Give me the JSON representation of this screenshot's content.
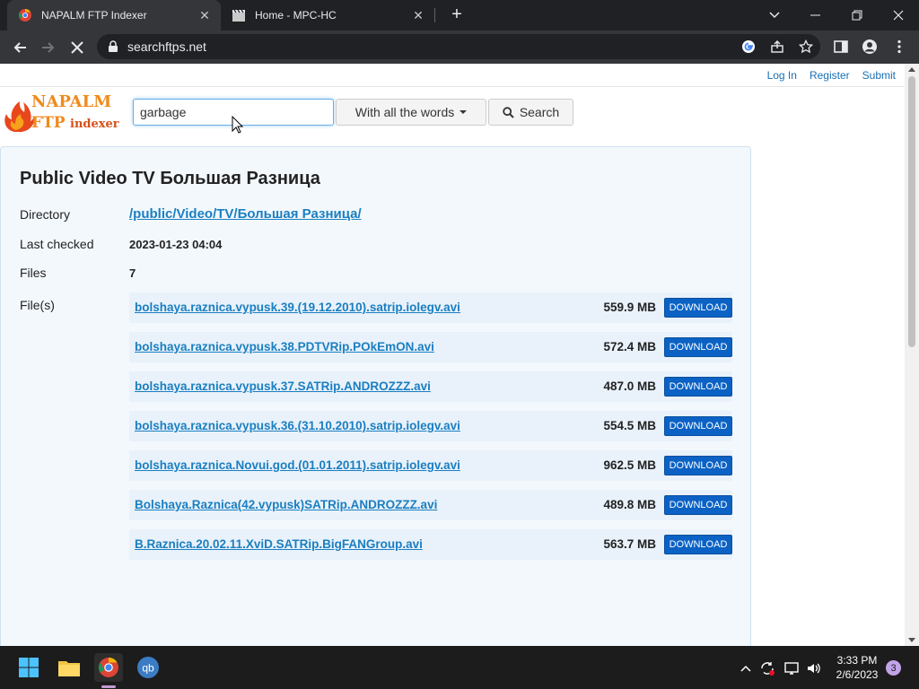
{
  "browser": {
    "tabs": [
      {
        "title": "NAPALM FTP Indexer",
        "active": true
      },
      {
        "title": "Home - MPC-HC",
        "active": false
      }
    ],
    "url": "searchftps.net"
  },
  "header": {
    "links": [
      "Log In",
      "Register",
      "Submit"
    ],
    "logo": {
      "line1": "NAPALM",
      "line2": "FTP",
      "line3": "indexer"
    }
  },
  "search": {
    "query": "garbage",
    "mode": "With all the words",
    "button": "Search"
  },
  "result": {
    "title": "Public Video TV Большая Разница",
    "directory_label": "Directory",
    "directory": "/public/Video/TV/Большая Разница/",
    "last_checked_label": "Last checked",
    "last_checked": "2023-01-23 04:04",
    "files_label": "Files",
    "files_count": "7",
    "filelist_label": "File(s)",
    "download_label": "DOWNLOAD",
    "files": [
      {
        "name": "bolshaya.raznica.vypusk.39.(19.12.2010).satrip.iolegv.avi",
        "size": "559.9 MB"
      },
      {
        "name": "bolshaya.raznica.vypusk.38.PDTVRip.POkEmON.avi",
        "size": "572.4 MB"
      },
      {
        "name": "bolshaya.raznica.vypusk.37.SATRip.ANDROZZZ.avi",
        "size": "487.0 MB"
      },
      {
        "name": "bolshaya.raznica.vypusk.36.(31.10.2010).satrip.iolegv.avi",
        "size": "554.5 MB"
      },
      {
        "name": "bolshaya.raznica.Novui.god.(01.01.2011).satrip.iolegv.avi",
        "size": "962.5 MB"
      },
      {
        "name": "Bolshaya.Raznica(42.vypusk)SATRip.ANDROZZZ.avi",
        "size": "489.8 MB"
      },
      {
        "name": "B.Raznica.20.02.11.XviD.SATRip.BigFANGroup.avi",
        "size": "563.7 MB"
      }
    ]
  },
  "taskbar": {
    "time": "3:33 PM",
    "date": "2/6/2023",
    "notifications": "3"
  },
  "colors": {
    "link": "#1a7fc1",
    "download_button": "#0b62c4",
    "panel_bg": "#f3f8fd"
  }
}
